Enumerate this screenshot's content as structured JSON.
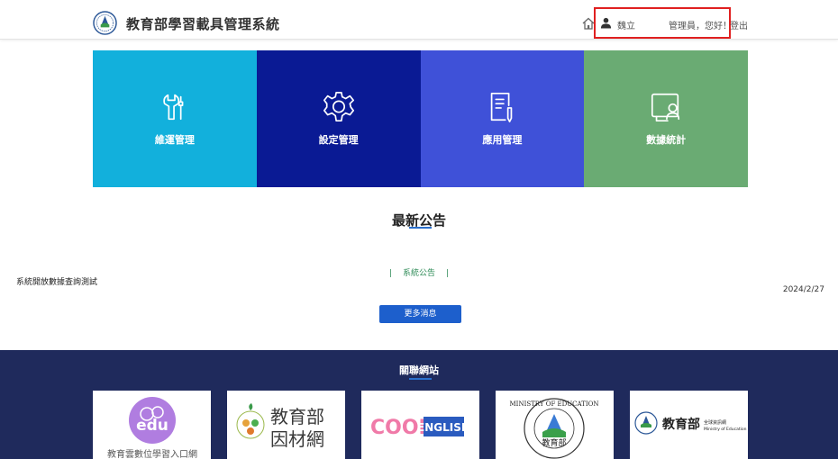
{
  "header": {
    "site_title": "教育部學習載具管理系統",
    "user_name": "魏立",
    "greeting": "管理員，您好！",
    "logout": "登出"
  },
  "tiles": [
    {
      "label": "維運管理",
      "color": "#12b0dc",
      "icon": "tools-icon"
    },
    {
      "label": "設定管理",
      "color": "#0a1a94",
      "icon": "gear-icon"
    },
    {
      "label": "應用管理",
      "color": "#3f51d8",
      "icon": "document-pen-icon"
    },
    {
      "label": "數據統計",
      "color": "#6aab73",
      "icon": "monitor-user-icon"
    }
  ],
  "news": {
    "heading": "最新公告",
    "tab": "系統公告",
    "items": [
      {
        "title": "系統開放數據查詢測試",
        "date": "2024/2/27"
      }
    ],
    "more_button": "更多消息"
  },
  "related": {
    "title": "關聯網站",
    "sites": [
      {
        "name": "教育雲數位學習入口網",
        "logo_text": "edu"
      },
      {
        "name": "教育部因材網",
        "logo_text": "教育部因材網"
      },
      {
        "name": "COOL ENGLISH",
        "logo_text": "COOL"
      },
      {
        "name": "MINISTRY OF EDUCATION",
        "logo_text": "MINISTRY OF EDUCATION"
      },
      {
        "name": "教育部 全球資訊網 Ministry of Education",
        "logo_text": "教育部"
      }
    ]
  },
  "colors": {
    "accent": "#1d5fcc",
    "footer_bg": "#1f2a5c",
    "highlight_box": "#e02020"
  }
}
